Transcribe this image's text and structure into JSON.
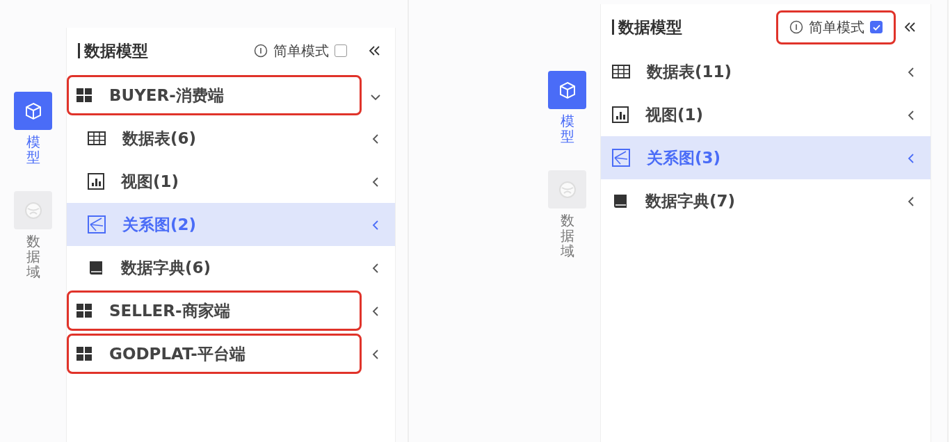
{
  "panels": [
    {
      "rail": [
        {
          "label": "模型",
          "selected": true
        },
        {
          "label": "数据域",
          "selected": false
        }
      ],
      "title": "数据模型",
      "simple_mode": {
        "label": "简单模式",
        "checked": false,
        "annotated": false
      },
      "tree": [
        {
          "kind": "group",
          "label": "BUYER-消费端",
          "expanded": true,
          "annotated": true,
          "children": [
            {
              "kind": "table",
              "label": "数据表(6)",
              "selected": false
            },
            {
              "kind": "view",
              "label": "视图(1)",
              "selected": false
            },
            {
              "kind": "diagram",
              "label": "关系图(2)",
              "selected": true
            },
            {
              "kind": "dictionary",
              "label": "数据字典(6)",
              "selected": false
            }
          ]
        },
        {
          "kind": "group",
          "label": "SELLER-商家端",
          "expanded": false,
          "annotated": true
        },
        {
          "kind": "group",
          "label": "GODPLAT-平台端",
          "expanded": false,
          "annotated": true
        }
      ]
    },
    {
      "rail": [
        {
          "label": "模型",
          "selected": true
        },
        {
          "label": "数据域",
          "selected": false
        }
      ],
      "title": "数据模型",
      "simple_mode": {
        "label": "简单模式",
        "checked": true,
        "annotated": true
      },
      "tree": [
        {
          "kind": "table",
          "label": "数据表(11)",
          "selected": false
        },
        {
          "kind": "view",
          "label": "视图(1)",
          "selected": false
        },
        {
          "kind": "diagram",
          "label": "关系图(3)",
          "selected": true
        },
        {
          "kind": "dictionary",
          "label": "数据字典(7)",
          "selected": false
        }
      ]
    }
  ]
}
